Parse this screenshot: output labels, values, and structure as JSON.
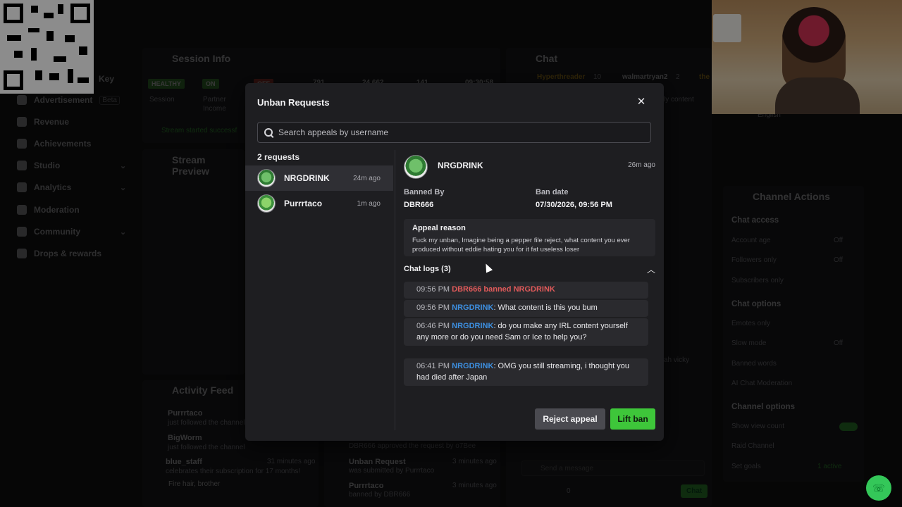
{
  "background": {
    "nav": [
      {
        "label": "Advertisement",
        "badge": "Beta"
      },
      {
        "label": "Revenue"
      },
      {
        "label": "Achievements"
      },
      {
        "label": "Studio"
      },
      {
        "label": "Analytics"
      },
      {
        "label": "Moderation"
      },
      {
        "label": "Community"
      },
      {
        "label": "Drops & rewards"
      }
    ],
    "nav_partial": "Key",
    "session": {
      "title": "Session Info",
      "tags": [
        "HEALTHY",
        "ON"
      ],
      "labels": [
        "Session",
        "Partner",
        "Income"
      ],
      "stats": [
        "791",
        "24,662",
        "141",
        "09:30:58"
      ],
      "status": "Stream started successf"
    },
    "stream_preview": "Stream Preview",
    "activity": {
      "title": "Activity Feed",
      "items": [
        {
          "name": "Purrrtaco",
          "sub": "just followed the channel"
        },
        {
          "name": "BigWorm",
          "sub": "just followed the channel"
        },
        {
          "name": "blue_staff",
          "sub": "celebrates their subscription for 17 months!",
          "time": "31 minutes ago",
          "msg": "Fire hair, brother"
        }
      ]
    },
    "activity2": [
      {
        "line": "DBR666 approved the request by o7Bee"
      },
      {
        "title": "Unban Request",
        "sub": "was submitted by Purrrtaco",
        "time": "3 minutes ago"
      },
      {
        "title": "Purrrtaco",
        "sub": "banned by DBR666",
        "time": "3 minutes ago"
      }
    ],
    "chat": {
      "title": "Chat",
      "top_users": [
        "Hyperthreader",
        "walmartryan2",
        "the"
      ],
      "top_counts": [
        "10",
        "2"
      ],
      "side_text": "ly content",
      "side_text2": "ah vicky",
      "placeholder": "Send a message",
      "count": "0",
      "send": "Chat"
    },
    "channel_actions": {
      "title": "Channel Actions",
      "lang": "English",
      "sections": [
        {
          "heading": "Chat access",
          "rows": [
            {
              "label": "Account age",
              "value": "Off"
            },
            {
              "label": "Followers only",
              "value": "Off"
            },
            {
              "label": "Subscribers only"
            }
          ]
        },
        {
          "heading": "Chat options",
          "rows": [
            {
              "label": "Emotes only"
            },
            {
              "label": "Slow mode",
              "value": "Off"
            },
            {
              "label": "Banned words"
            },
            {
              "label": "AI Chat Moderation"
            }
          ]
        },
        {
          "heading": "Channel options",
          "rows": [
            {
              "label": "Show view count"
            },
            {
              "label": "Raid Channel"
            },
            {
              "label": "Set goals",
              "value": "1 active"
            }
          ]
        }
      ]
    }
  },
  "modal": {
    "title": "Unban Requests",
    "search_placeholder": "Search appeals by username",
    "count_label": "2 requests",
    "requests": [
      {
        "username": "NRGDRINK",
        "ago": "24m ago"
      },
      {
        "username": "Purrrtaco",
        "ago": "1m ago"
      }
    ],
    "detail": {
      "username": "NRGDRINK",
      "ago": "26m ago",
      "banned_by_label": "Banned By",
      "banned_by": "DBR666",
      "ban_date_label": "Ban date",
      "ban_date": "07/30/2026, 09:56 PM",
      "reason_title": "Appeal reason",
      "reason_text": "Fuck my unban, Imagine being a pepper file reject, what content you ever produced without eddie hating you for it fat useless loser",
      "logs_title": "Chat logs (3)",
      "logs": [
        {
          "time": "09:56 PM",
          "ban_text": "DBR666 banned NRGDRINK"
        },
        {
          "time": "09:56 PM",
          "user": "NRGDRINK",
          "text": ": What content is this you bum"
        },
        {
          "time": "06:46 PM",
          "user": "NRGDRINK",
          "text": ": do you make any IRL content yourself any more or do you need Sam or Ice to help you?"
        },
        {
          "time": "06:41 PM",
          "user": "NRGDRINK",
          "text": ": OMG you still streaming, i thought you had died after Japan"
        }
      ]
    },
    "reject_label": "Reject appeal",
    "lift_label": "Lift ban"
  },
  "colors": {
    "accent": "#3ec63a",
    "username": "#3d8fe0",
    "ban": "#e05a5a"
  }
}
